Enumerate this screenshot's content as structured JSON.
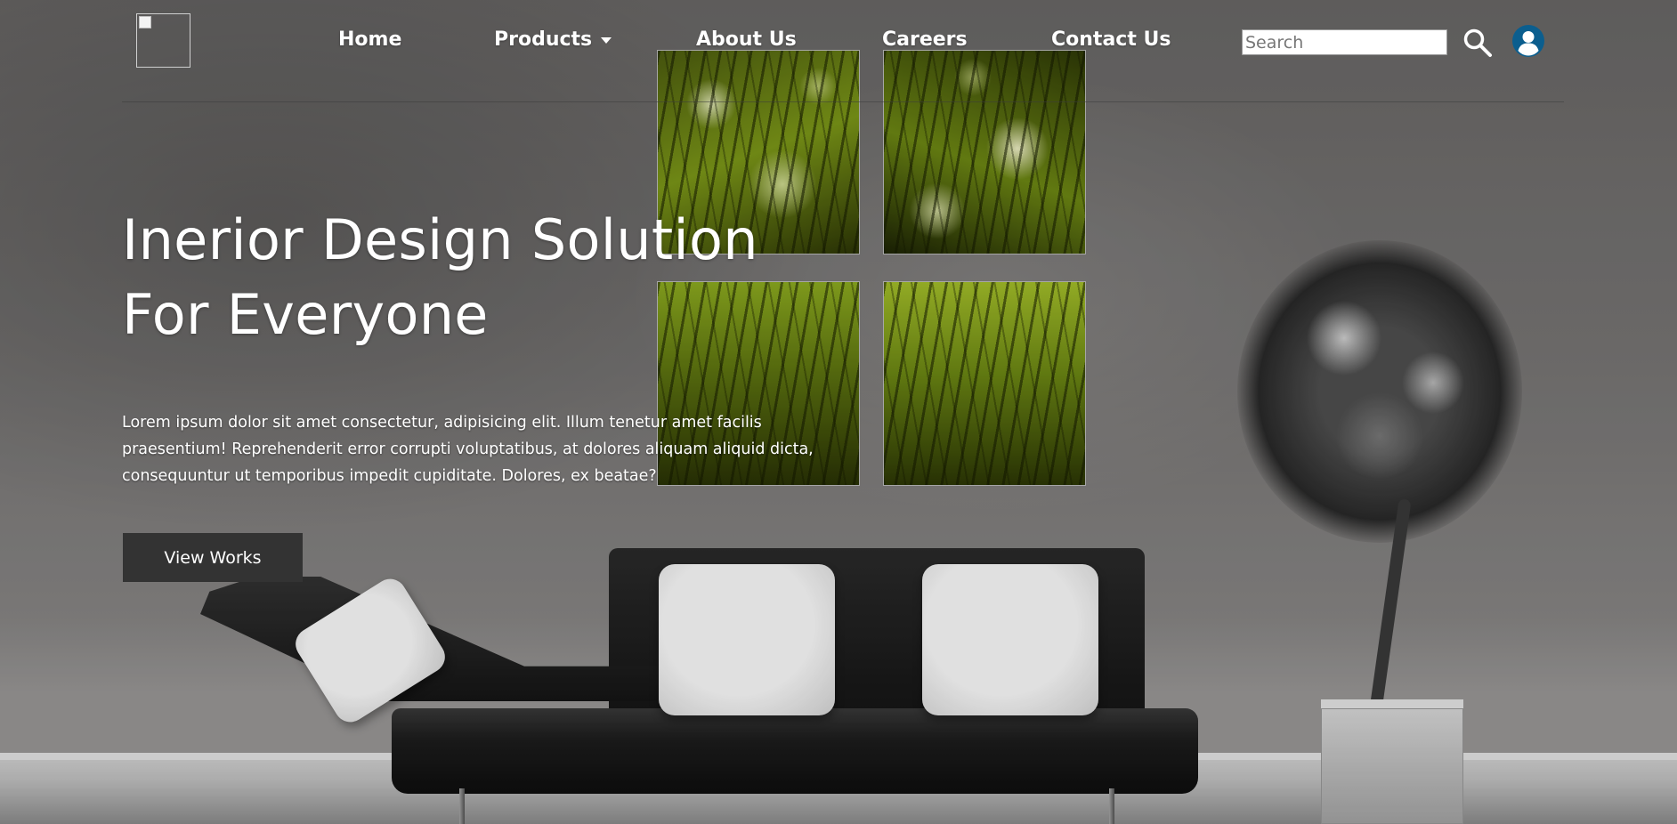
{
  "header": {
    "nav": [
      {
        "label": "Home"
      },
      {
        "label": "Products",
        "has_dropdown": true
      },
      {
        "label": "About Us"
      },
      {
        "label": "Careers"
      },
      {
        "label": "Contact Us"
      }
    ],
    "search": {
      "placeholder": "Search",
      "value": ""
    },
    "icons": {
      "search": "search-icon",
      "user": "user-circle-icon",
      "logo": "broken-image-icon"
    }
  },
  "hero": {
    "title_line1": "Inerior Design Solution",
    "title_line2": "For Everyone",
    "body": "Lorem ipsum dolor sit amet consectetur, adipisicing elit. Illum tenetur amet facilis praesentium! Reprehenderit error corrupti voluptatibus, at dolores aliquam aliquid dicta, consequuntur ut temporibus impedit cupiditate. Dolores, ex beatae?",
    "cta_label": "View Works"
  },
  "colors": {
    "avatar": "#0b5e8e",
    "cta_background": "#333333",
    "text": "#ffffff"
  }
}
